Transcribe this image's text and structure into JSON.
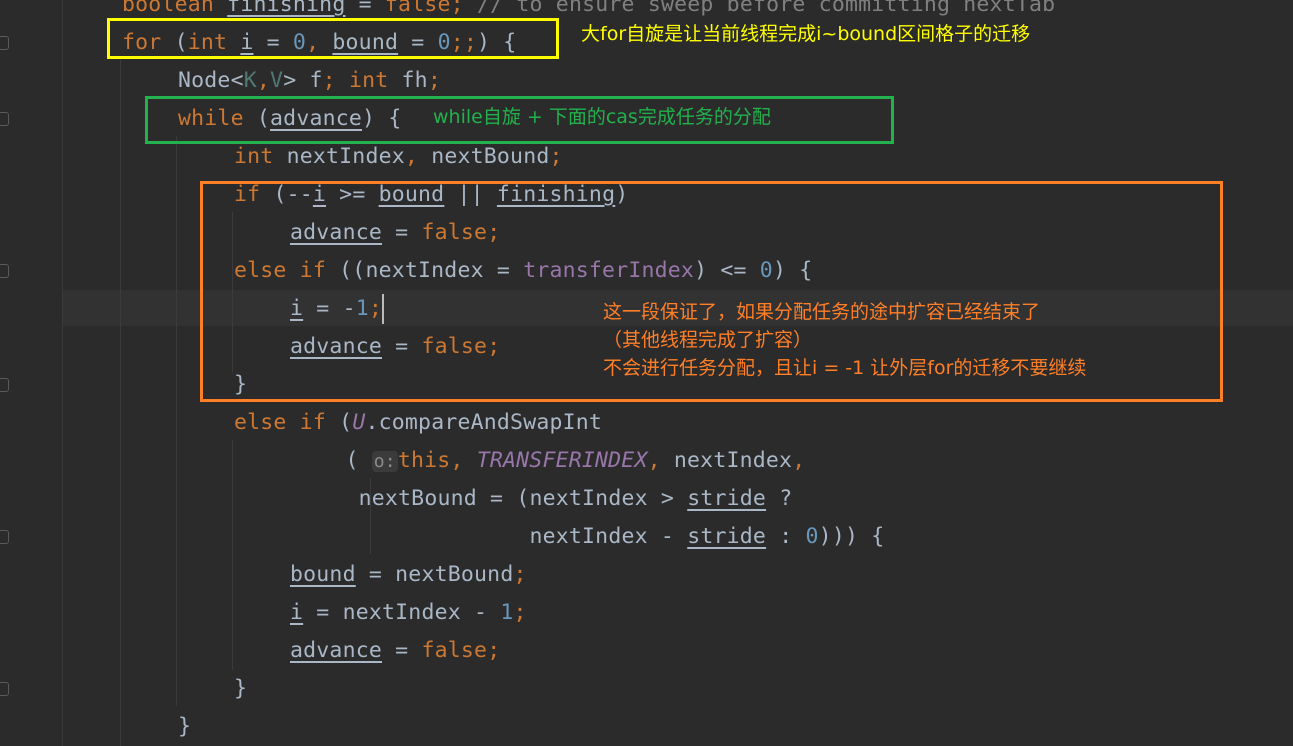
{
  "editor": {
    "colors": {
      "background": "#2b2b2b",
      "keyword": "#cc7832",
      "number": "#6897bb",
      "text": "#a9b7c6",
      "comment": "#808080",
      "field": "#9876aa",
      "type_param": "#507874"
    },
    "current_line": 8,
    "lines": [
      {
        "indent": 0,
        "tokens": [
          [
            "boolean",
            "kw"
          ],
          [
            " "
          ],
          [
            "finishing",
            "ul"
          ],
          [
            " = "
          ],
          [
            "false",
            "kw"
          ],
          [
            ";",
            "kw"
          ],
          [
            " // to ensure sweep before committing nextTab",
            "cm"
          ]
        ]
      },
      {
        "indent": 0,
        "tokens": [
          [
            "for",
            "kw"
          ],
          [
            " ("
          ],
          [
            "int",
            "kw"
          ],
          [
            " "
          ],
          [
            "i",
            "ul"
          ],
          [
            " = "
          ],
          [
            "0",
            "num"
          ],
          [
            ",",
            "kw"
          ],
          [
            " "
          ],
          [
            "bound",
            "ul"
          ],
          [
            " = "
          ],
          [
            "0",
            "num"
          ],
          [
            ";;",
            "kw"
          ],
          [
            ") {"
          ]
        ]
      },
      {
        "indent": 1,
        "tokens": [
          [
            "Node<"
          ],
          [
            "K",
            "tp"
          ],
          [
            ",",
            "kw"
          ],
          [
            "V",
            "tp"
          ],
          [
            "> f"
          ],
          [
            ";",
            "kw"
          ],
          [
            " "
          ],
          [
            "int",
            "kw"
          ],
          [
            " fh"
          ],
          [
            ";",
            "kw"
          ]
        ]
      },
      {
        "indent": 1,
        "tokens": [
          [
            "while",
            "kw"
          ],
          [
            " ("
          ],
          [
            "advance",
            "ul"
          ],
          [
            ") {"
          ]
        ]
      },
      {
        "indent": 2,
        "tokens": [
          [
            "int",
            "kw"
          ],
          [
            " nextIndex"
          ],
          [
            ",",
            "kw"
          ],
          [
            " nextBound"
          ],
          [
            ";",
            "kw"
          ]
        ]
      },
      {
        "indent": 2,
        "tokens": [
          [
            "if",
            "kw"
          ],
          [
            " (--"
          ],
          [
            "i",
            "ul"
          ],
          [
            " >= "
          ],
          [
            "bound",
            "ul"
          ],
          [
            " || "
          ],
          [
            "finishing",
            "ul"
          ],
          [
            ")"
          ]
        ]
      },
      {
        "indent": 3,
        "tokens": [
          [
            "advance",
            "ul"
          ],
          [
            " = "
          ],
          [
            "false",
            "kw"
          ],
          [
            ";",
            "kw"
          ]
        ]
      },
      {
        "indent": 2,
        "tokens": [
          [
            "else if",
            "kw"
          ],
          [
            " ((nextIndex = "
          ],
          [
            "transferIndex",
            "fld"
          ],
          [
            ") <= "
          ],
          [
            "0",
            "num"
          ],
          [
            ") {"
          ]
        ]
      },
      {
        "indent": 3,
        "tokens": [
          [
            "i",
            "ul"
          ],
          [
            " = -"
          ],
          [
            "1",
            "num"
          ],
          [
            ";",
            "kw"
          ],
          [
            "",
            "cursor"
          ]
        ]
      },
      {
        "indent": 3,
        "tokens": [
          [
            "advance",
            "ul"
          ],
          [
            " = "
          ],
          [
            "false",
            "kw"
          ],
          [
            ";",
            "kw"
          ]
        ]
      },
      {
        "indent": 2,
        "tokens": [
          [
            "}"
          ]
        ]
      },
      {
        "indent": 2,
        "tokens": [
          [
            "else if",
            "kw"
          ],
          [
            " ("
          ],
          [
            "U",
            "fld it"
          ],
          [
            ".compareAndSwapInt"
          ]
        ]
      },
      {
        "indent": 0,
        "tokens": [
          [
            "                 ( "
          ],
          [
            "o:",
            "hint"
          ],
          [
            "this",
            "kw"
          ],
          [
            ",",
            "kw"
          ],
          [
            " "
          ],
          [
            "TRANSFERINDEX",
            "fld it"
          ],
          [
            ",",
            "kw"
          ],
          [
            " nextIndex"
          ],
          [
            ",",
            "kw"
          ]
        ]
      },
      {
        "indent": 0,
        "tokens": [
          [
            "                  nextBound = (nextIndex > "
          ],
          [
            "stride",
            "ul"
          ],
          [
            " ?"
          ]
        ]
      },
      {
        "indent": 0,
        "tokens": [
          [
            "                               nextIndex - "
          ],
          [
            "stride",
            "ul"
          ],
          [
            " : "
          ],
          [
            "0",
            "num"
          ],
          [
            "))) {"
          ]
        ]
      },
      {
        "indent": 3,
        "tokens": [
          [
            "bound",
            "ul"
          ],
          [
            " = nextBound"
          ],
          [
            ";",
            "kw"
          ]
        ]
      },
      {
        "indent": 3,
        "tokens": [
          [
            "i",
            "ul"
          ],
          [
            " = nextIndex - "
          ],
          [
            "1",
            "num"
          ],
          [
            ";",
            "kw"
          ]
        ]
      },
      {
        "indent": 3,
        "tokens": [
          [
            "advance",
            "ul"
          ],
          [
            " = "
          ],
          [
            "false",
            "kw"
          ],
          [
            ";",
            "kw"
          ]
        ]
      },
      {
        "indent": 2,
        "tokens": [
          [
            "}"
          ]
        ]
      },
      {
        "indent": 1,
        "tokens": [
          [
            "}"
          ]
        ]
      }
    ]
  },
  "annotations": {
    "for_note": {
      "text": "大for自旋是让当前线程完成i~bound区间格子的迁移",
      "color": "#ffff00"
    },
    "while_note": {
      "text": "while自旋 + 下面的cas完成任务的分配",
      "color": "#22b14c"
    },
    "if_note": {
      "color": "#ff7f27",
      "lines": [
        "这一段保证了，如果分配任务的途中扩容已经结束了",
        "（其他线程完成了扩容）",
        "不会进行任务分配，且让i = -1 让外层for的迁移不要继续"
      ]
    }
  }
}
